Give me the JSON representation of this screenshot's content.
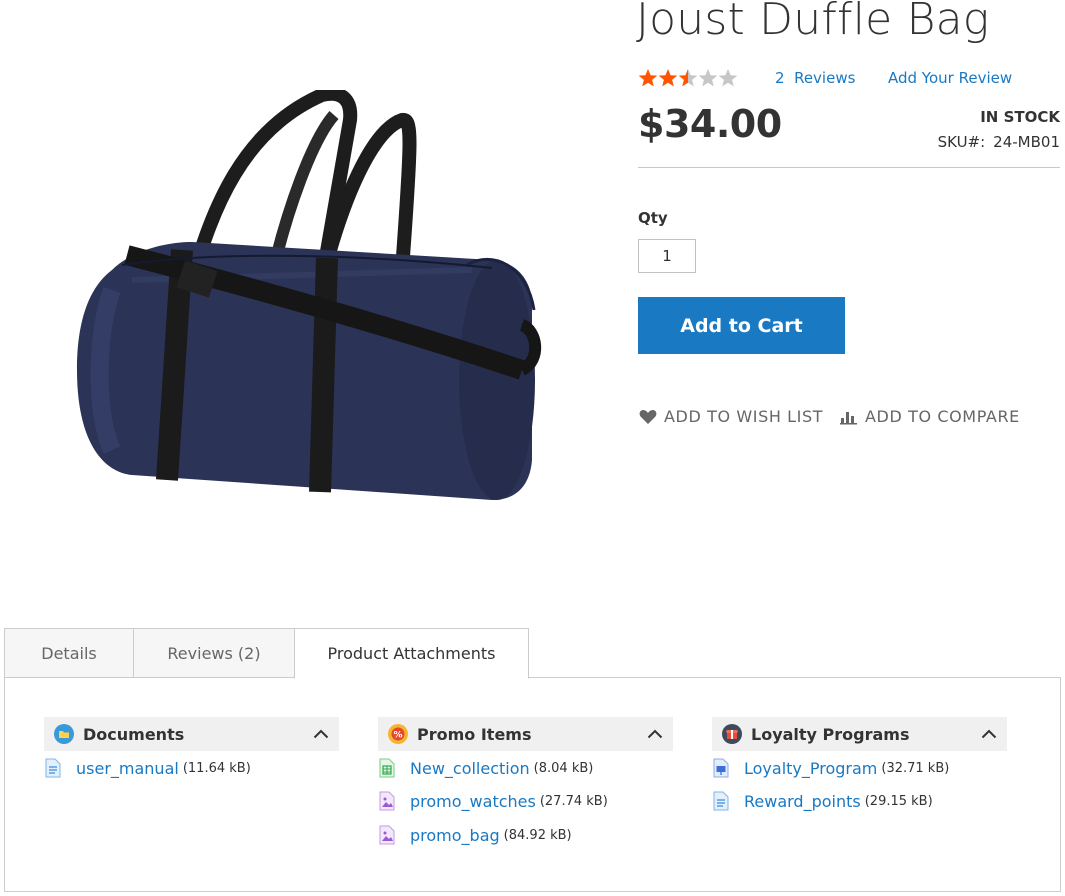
{
  "product": {
    "title": "Joust Duffle Bag",
    "rating_stars": 2.5,
    "reviews_link": "2  Reviews",
    "add_review": "Add Your Review",
    "price": "$34.00",
    "stock": "IN STOCK",
    "sku_label": "SKU#:",
    "sku_value": "24-MB01",
    "qty_label": "Qty",
    "qty_value": "1",
    "add_to_cart": "Add to Cart",
    "wish_list": "ADD TO WISH LIST",
    "compare": "ADD TO COMPARE"
  },
  "tabs": [
    {
      "label": "Details"
    },
    {
      "label": "Reviews (2)"
    },
    {
      "label": "Product Attachments"
    }
  ],
  "groups": [
    {
      "title": "Documents",
      "files": [
        {
          "name": "user_manual",
          "size": "(11.64 kB)"
        }
      ]
    },
    {
      "title": "Promo Items",
      "files": [
        {
          "name": "New_collection",
          "size": "(8.04 kB)"
        },
        {
          "name": "promo_watches",
          "size": "(27.74 kB)"
        },
        {
          "name": "promo_bag",
          "size": "(84.92 kB)"
        }
      ]
    },
    {
      "title": "Loyalty Programs",
      "files": [
        {
          "name": "Loyalty_Program",
          "size": "(32.71 kB)"
        },
        {
          "name": "Reward_points",
          "size": "(29.15 kB)"
        }
      ]
    }
  ],
  "colors": {
    "link": "#1979c3",
    "button": "#1979c3",
    "star": "#ff5501"
  }
}
